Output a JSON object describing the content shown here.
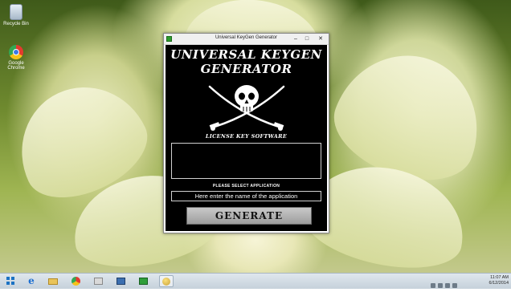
{
  "desktop": {
    "icons": [
      {
        "label": "Recycle Bin"
      },
      {
        "label": "Google Chrome"
      }
    ]
  },
  "window": {
    "title": "Universal KeyGen Generator",
    "controls": {
      "minimize": "–",
      "maximize": "□",
      "close": "✕"
    },
    "heading_line1": "UNIVERSAL KEYGEN",
    "heading_line2": "GENERATOR",
    "tagline": "LICENSE KEY SOFTWARE",
    "output_text": "",
    "select_label": "PLEASE SELECT APPLICATION",
    "app_input_placeholder": "Here enter the name of the application",
    "generate_label": "GENERATE"
  },
  "taskbar": {
    "clock_time": "11:07 AM",
    "clock_date": "6/12/2014"
  },
  "colors": {
    "window_bg": "#000000",
    "button_bg": "#bdbdbd",
    "text": "#ffffff"
  }
}
